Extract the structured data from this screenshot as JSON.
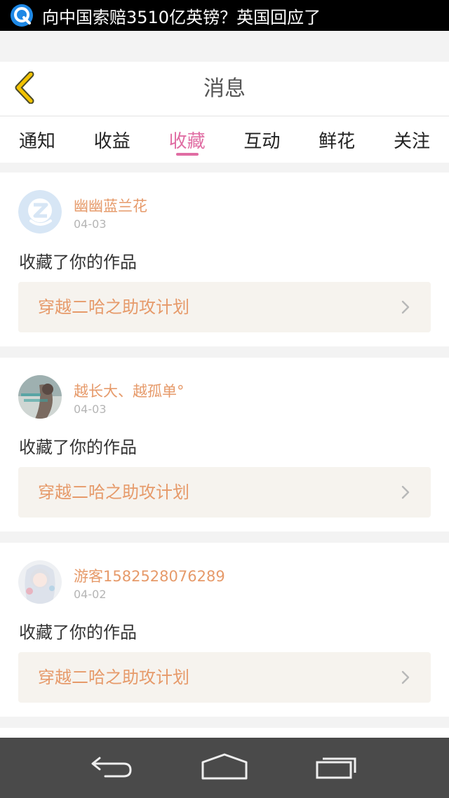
{
  "status_bar": {
    "logo_icon": "news-q-icon",
    "headline": "向中国索赔3510亿英镑？英国回应了"
  },
  "header": {
    "back_icon": "back-chevron-icon",
    "title": "消息"
  },
  "tabs": [
    {
      "label": "通知",
      "active": false
    },
    {
      "label": "收益",
      "active": false
    },
    {
      "label": "收藏",
      "active": true
    },
    {
      "label": "互动",
      "active": false
    },
    {
      "label": "鲜花",
      "active": false
    },
    {
      "label": "关注",
      "active": false
    }
  ],
  "messages": [
    {
      "username": "幽幽蓝兰花",
      "date": "04-03",
      "action": "收藏了你的作品",
      "work_title": "穿越二哈之助攻计划"
    },
    {
      "username": "越长大、越孤单°",
      "date": "04-03",
      "action": "收藏了你的作品",
      "work_title": "穿越二哈之助攻计划"
    },
    {
      "username": "游客1582528076289",
      "date": "04-02",
      "action": "收藏了你的作品",
      "work_title": "穿越二哈之助攻计划"
    }
  ],
  "colors": {
    "accent_pink": "#e06da3",
    "name_orange": "#e69a6a",
    "back_yellow": "#f2c200"
  },
  "nav_bar": {
    "back_icon": "nav-back-icon",
    "home_icon": "nav-home-icon",
    "recents_icon": "nav-recents-icon"
  }
}
